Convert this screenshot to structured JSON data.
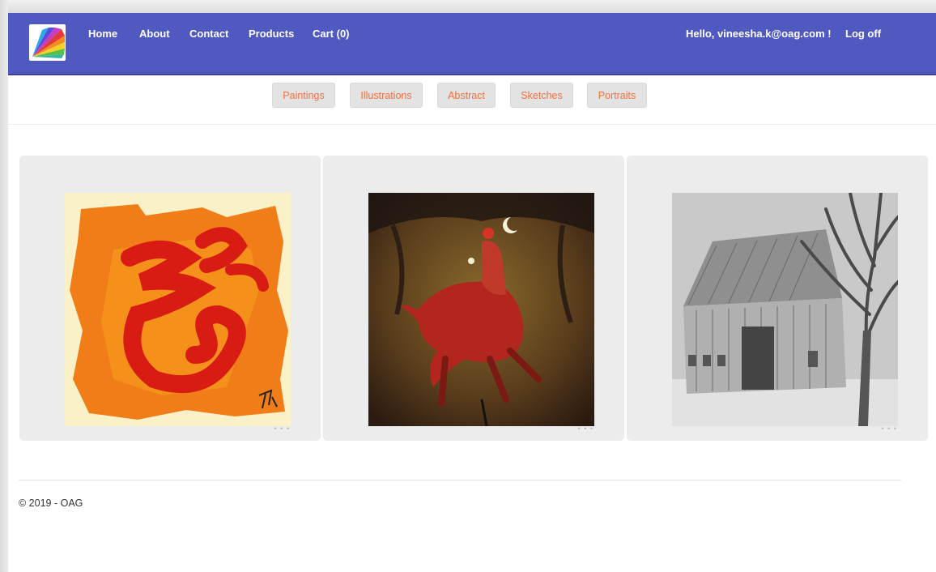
{
  "navbar": {
    "links": [
      "Home",
      "About",
      "Contact",
      "Products",
      "Cart (0)"
    ],
    "greeting": "Hello, vineesha.k@oag.com !",
    "logoff": "Log off",
    "background": "#5059bf"
  },
  "categories": [
    "Paintings",
    "Illustrations",
    "Abstract",
    "Sketches",
    "Portraits"
  ],
  "gallery": [
    {
      "icon": "red-calligraphy-abstract-painting"
    },
    {
      "icon": "horse-and-rider-painting"
    },
    {
      "icon": "barn-pencil-sketch"
    }
  ],
  "footer": {
    "text": "© 2019 - OAG"
  },
  "colors": {
    "accent": "#f46f3d",
    "card_bg": "#ececec"
  }
}
